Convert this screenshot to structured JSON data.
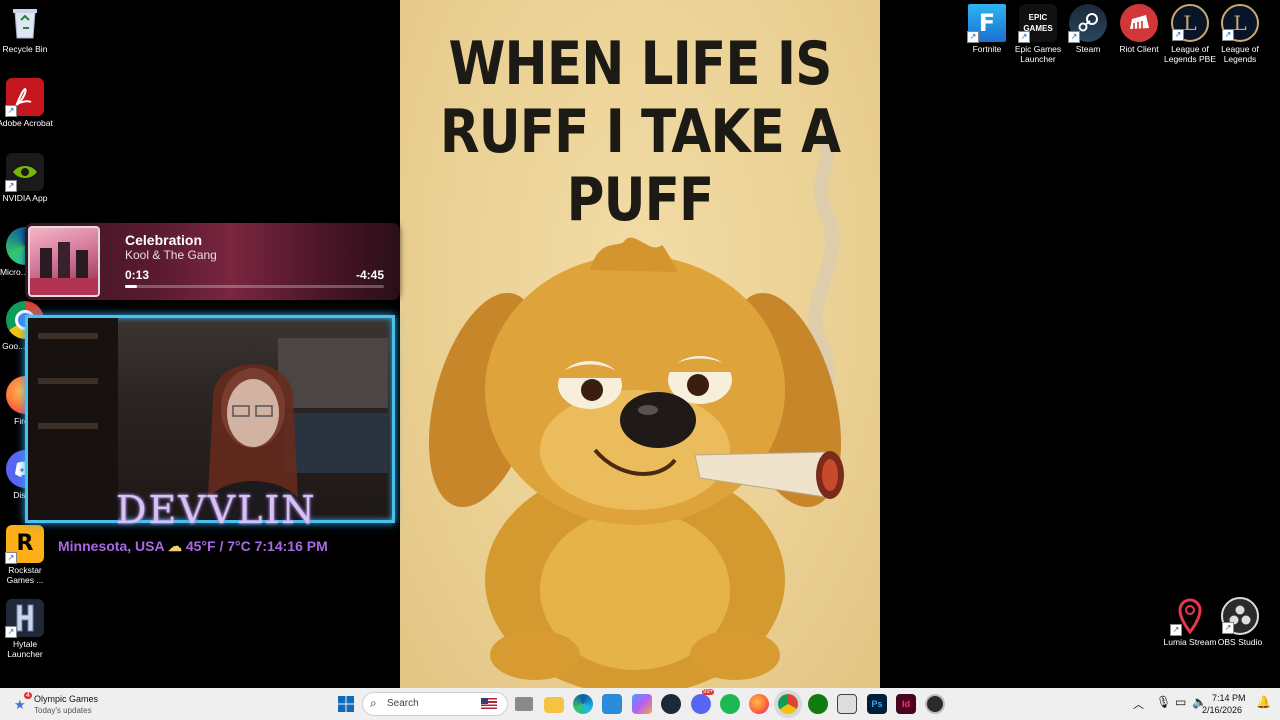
{
  "desktop_left": [
    {
      "label": "Recycle Bin",
      "icon": "recycle-bin-icon"
    },
    {
      "label": "Adobe Acrobat",
      "icon": "acrobat-icon"
    },
    {
      "label": "NVIDIA App",
      "icon": "nvidia-icon"
    },
    {
      "label": "Micro... Edge",
      "icon": "edge-icon"
    },
    {
      "label": "Goo... Chr...",
      "icon": "chrome-icon"
    },
    {
      "label": "Fire...",
      "icon": "firefox-icon"
    },
    {
      "label": "Disc...",
      "icon": "discord-icon"
    },
    {
      "label": "Rockstar Games ...",
      "icon": "rockstar-icon"
    },
    {
      "label": "Hytale Launcher",
      "icon": "hytale-icon"
    }
  ],
  "desktop_right": [
    {
      "label": "Fortnite",
      "icon": "fortnite-icon"
    },
    {
      "label": "Epic Games Launcher",
      "icon": "epic-games-icon"
    },
    {
      "label": "Steam",
      "icon": "steam-icon"
    },
    {
      "label": "Riot Client",
      "icon": "riot-client-icon"
    },
    {
      "label": "League of Legends PBE",
      "icon": "league-pbe-icon"
    },
    {
      "label": "League of Legends",
      "icon": "league-icon"
    },
    {
      "label": "Lumia Stream",
      "icon": "lumia-stream-icon"
    },
    {
      "label": "OBS Studio",
      "icon": "obs-icon"
    }
  ],
  "epic_logo_text": "EPIC GAMES",
  "poster": {
    "caption": "WHEN LIFE IS RUFF I TAKE A PUFF"
  },
  "music": {
    "title": "Celebration",
    "artist": "Kool & The Gang",
    "elapsed": "0:13",
    "remaining": "-4:45",
    "progress": 0.046
  },
  "overlay": {
    "brand": "DEVVLIN",
    "location": "Minnesota, USA",
    "weather": "45°F / 7°C",
    "time": "7:14:16 PM"
  },
  "taskbar": {
    "news_title": "Olympic Games",
    "news_subtitle": "Today's updates",
    "news_badge": "4",
    "search_label": "Search",
    "clock_time": "7:14 PM",
    "clock_date": "2/16/2026",
    "discord_badge": "99+"
  },
  "colors": {
    "accent_cam_border": "#49c0ee",
    "overlay_text": "#a869e6",
    "poster_bg": "#ead093"
  }
}
